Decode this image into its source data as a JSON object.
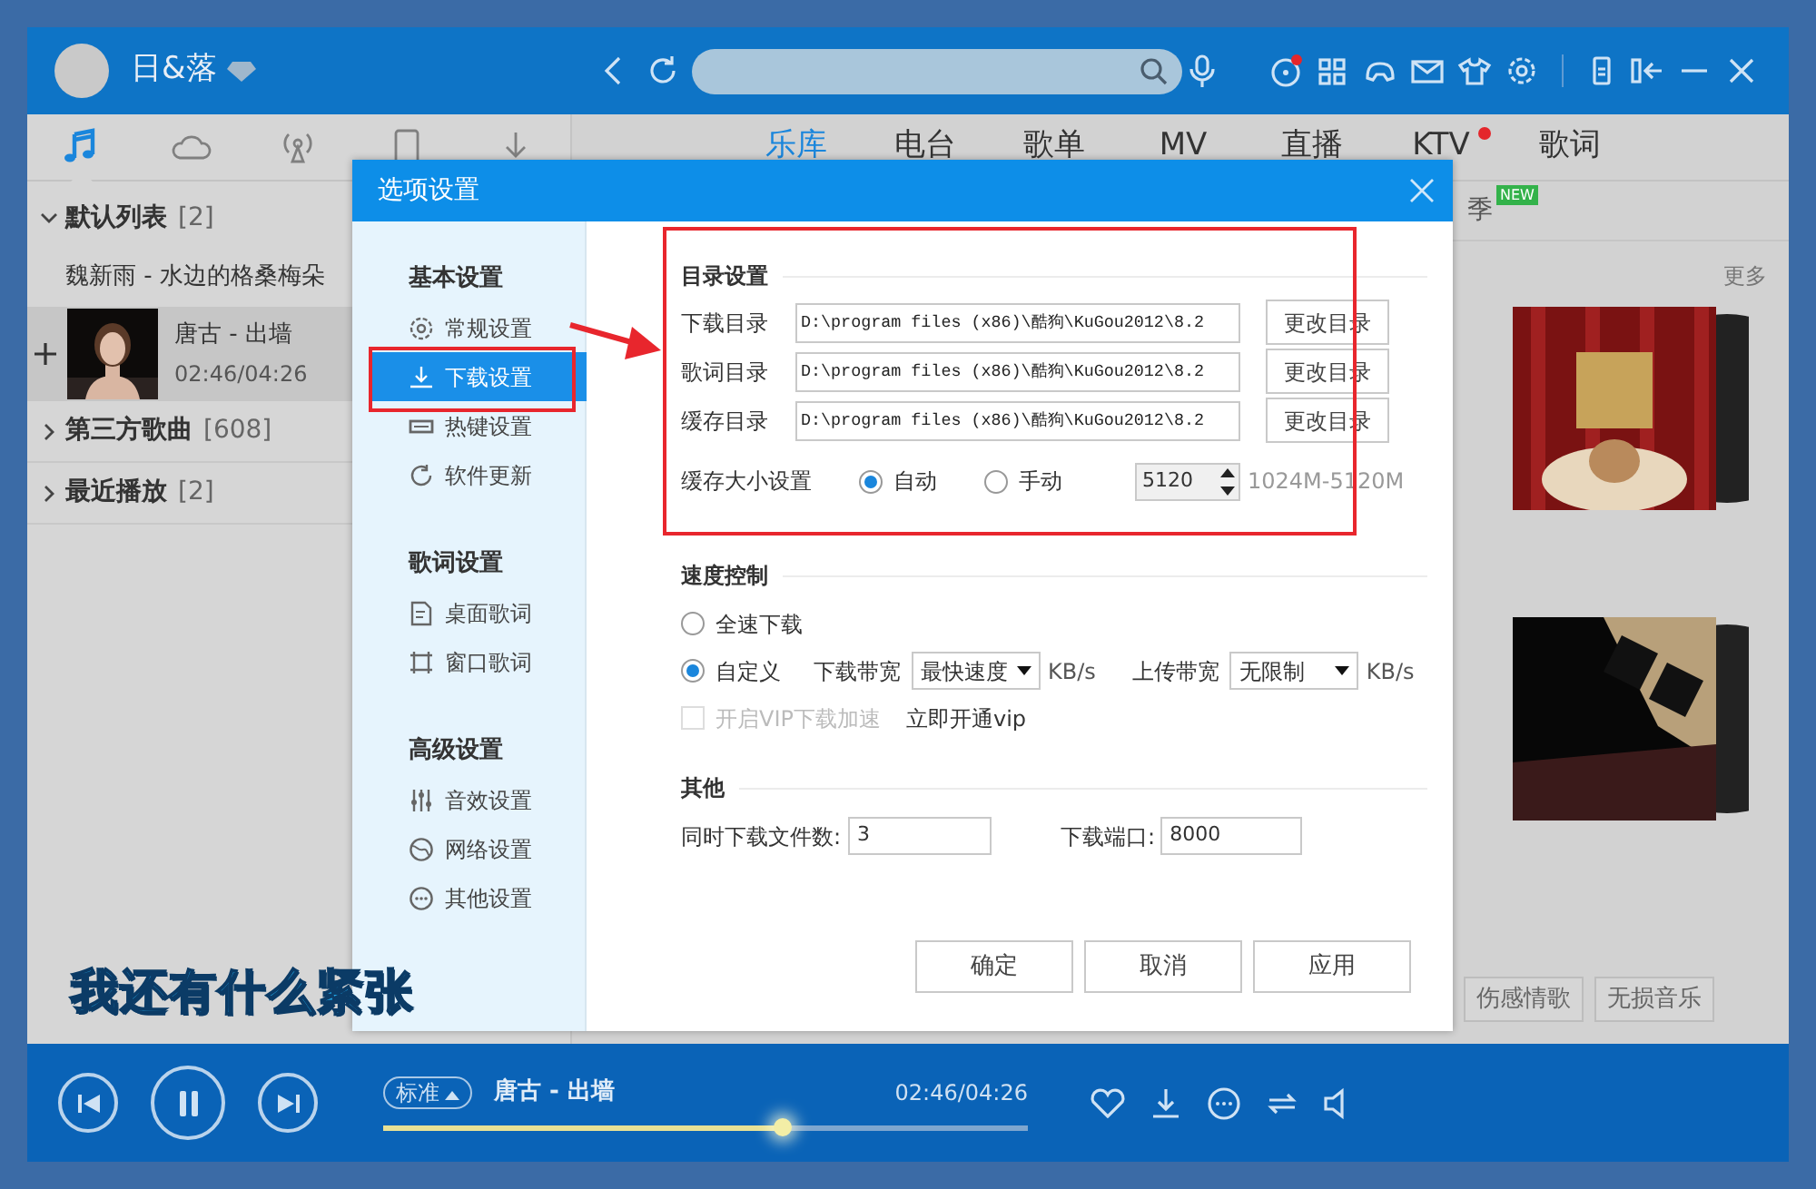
{
  "header": {
    "user": "日&落"
  },
  "left_tabs": [
    {
      "kind": "music",
      "selected": true
    },
    {
      "kind": "cloud",
      "selected": false
    },
    {
      "kind": "radio",
      "selected": false
    },
    {
      "kind": "device",
      "selected": false
    },
    {
      "kind": "download",
      "selected": false
    }
  ],
  "playlists": [
    {
      "name": "默认列表",
      "count": "[2]",
      "expanded": true,
      "songs": [
        {
          "title": "魏新雨 - 水边的格桑梅朵",
          "playing": false
        },
        {
          "title": "唐古 - 出墙",
          "time": "02:46/04:26",
          "playing": true
        }
      ]
    },
    {
      "name": "第三方歌曲",
      "count": "[608]",
      "expanded": false
    },
    {
      "name": "最近播放",
      "count": "[2]",
      "expanded": false
    }
  ],
  "nav_tabs": [
    {
      "label": "乐库",
      "selected": true,
      "dot": false
    },
    {
      "label": "电台",
      "selected": false,
      "dot": false
    },
    {
      "label": "歌单",
      "selected": false,
      "dot": false
    },
    {
      "label": "MV",
      "selected": false,
      "dot": false
    },
    {
      "label": "直播",
      "selected": false,
      "dot": false
    },
    {
      "label": "KTV",
      "selected": false,
      "dot": true
    },
    {
      "label": "歌词",
      "selected": false,
      "dot": false
    }
  ],
  "sub_nav": {
    "label": "季",
    "badge": "NEW"
  },
  "more_link": "更多",
  "albums": [
    {
      "kind": "picture"
    },
    {
      "kind": "picture"
    }
  ],
  "tag_buttons": [
    "伤感情歌",
    "无损音乐"
  ],
  "lyrics_overlay": "我还有什么紧张",
  "player": {
    "quality": "标准",
    "song": "唐古 - 出墙",
    "time": "02:46/04:26",
    "level": 0.62
  },
  "dialog": {
    "title": "选项设置",
    "nav": [
      {
        "heading": "基本设置",
        "items": [
          {
            "label": "常规设置",
            "kind": "gear",
            "selected": false
          },
          {
            "label": "下载设置",
            "kind": "download",
            "selected": true
          },
          {
            "label": "热键设置",
            "kind": "keyboard",
            "selected": false
          },
          {
            "label": "软件更新",
            "kind": "update",
            "selected": false
          }
        ]
      },
      {
        "heading": "歌词设置",
        "items": [
          {
            "label": "桌面歌词",
            "kind": "lyrics",
            "selected": false
          },
          {
            "label": "窗口歌词",
            "kind": "frame",
            "selected": false
          }
        ]
      },
      {
        "heading": "高级设置",
        "items": [
          {
            "label": "音效设置",
            "kind": "equalizer",
            "selected": false
          },
          {
            "label": "网络设置",
            "kind": "globe",
            "selected": false
          },
          {
            "label": "其他设置",
            "kind": "more",
            "selected": false
          }
        ]
      }
    ],
    "directory": {
      "title": "目录设置",
      "rows": [
        {
          "label": "下载目录",
          "value": "D:\\program files (x86)\\酷狗\\KuGou2012\\8.2",
          "button": "更改目录"
        },
        {
          "label": "歌词目录",
          "value": "D:\\program files (x86)\\酷狗\\KuGou2012\\8.2",
          "button": "更改目录"
        },
        {
          "label": "缓存目录",
          "value": "D:\\program files (x86)\\酷狗\\KuGou2012\\8.2",
          "button": "更改目录"
        }
      ],
      "cache_label": "缓存大小设置",
      "cache_options": [
        {
          "label": "自动",
          "selected": true
        },
        {
          "label": "手动",
          "selected": false
        }
      ],
      "cache_size": "5120",
      "cache_range": "1024M-5120M"
    },
    "speed": {
      "title": "速度控制",
      "options": [
        {
          "label": "全速下载",
          "selected": false
        },
        {
          "label": "自定义",
          "selected": true
        }
      ],
      "download_label": "下载带宽",
      "download_value": "最快速度",
      "download_unit": "KB/s",
      "upload_label": "上传带宽",
      "upload_value": "无限制",
      "upload_unit": "KB/s",
      "vip": {
        "label": "开启VIP下载加速",
        "checked": false,
        "disabled": true
      },
      "vip_link": "立即开通vip"
    },
    "other": {
      "title": "其他",
      "concurrent_label": "同时下载文件数:",
      "concurrent_value": "3",
      "port_label": "下载端口:",
      "port_value": "8000"
    },
    "buttons": [
      "确定",
      "取消",
      "应用"
    ]
  }
}
